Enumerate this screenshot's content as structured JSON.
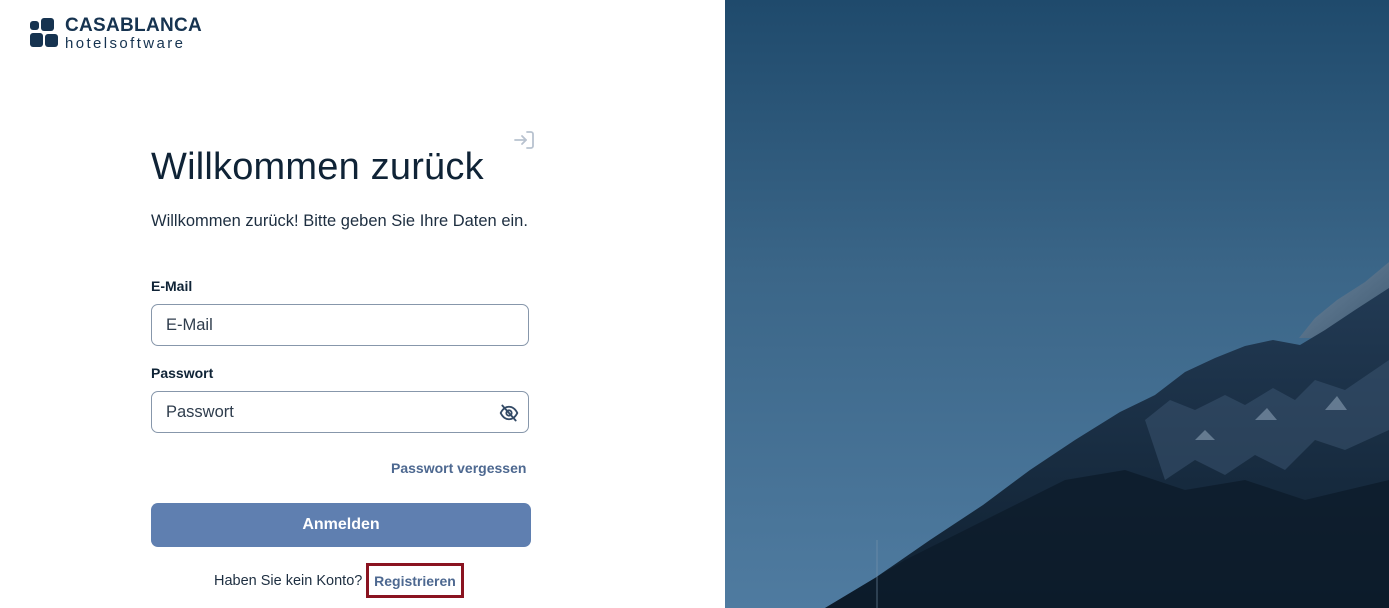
{
  "brand": {
    "name": "CASABLANCA",
    "subtitle": "hotelsoftware",
    "color": "#163350"
  },
  "login": {
    "title": "Willkommen zurück",
    "description": "Willkommen zurück! Bitte geben Sie Ihre Daten ein.",
    "email": {
      "label": "E-Mail",
      "placeholder": "E-Mail",
      "value": ""
    },
    "password": {
      "label": "Passwort",
      "placeholder": "Passwort",
      "value": ""
    },
    "forgot_label": "Passwort vergessen",
    "submit_label": "Anmelden",
    "no_account_text": "Haben Sie kein Konto?",
    "register_label": "Registrieren"
  },
  "icons": {
    "login": "login-arrow-icon",
    "password_toggle": "eye-off-icon"
  },
  "colors": {
    "primary_button": "#5f7fb0",
    "link": "#4d6890",
    "highlight_border": "#8a1320",
    "text": "#0f2336"
  }
}
